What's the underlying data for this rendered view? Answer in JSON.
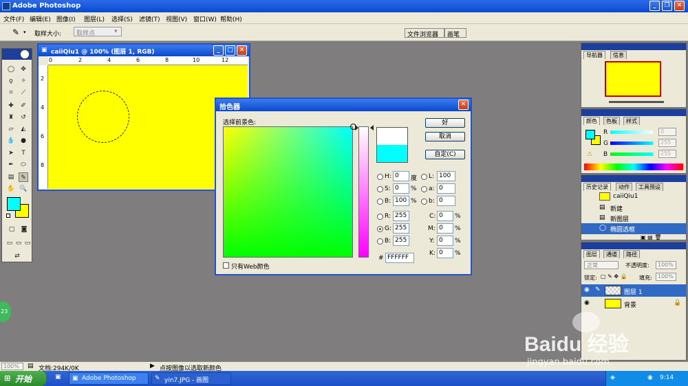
{
  "app": {
    "title": "Adobe Photoshop"
  },
  "menu": [
    "文件(F)",
    "编辑(E)",
    "图像(I)",
    "图层(L)",
    "选择(S)",
    "滤镜(T)",
    "视图(V)",
    "窗口(W)",
    "帮助(H)"
  ],
  "options": {
    "sample_label": "取样大小:",
    "sample_value": "取样点"
  },
  "tab_well": {
    "tabs": [
      "文件浏览器",
      "画笔"
    ]
  },
  "document": {
    "title": "caiiQiu1 @ 100% (图层 1, RGB)",
    "ruler_h": [
      "0",
      "2",
      "4",
      "6",
      "8",
      "10",
      "12"
    ],
    "ruler_v": [
      "2",
      "4",
      "6",
      "8"
    ]
  },
  "dialog": {
    "title": "拾色器",
    "prompt": "选择前景色:",
    "ok": "好",
    "cancel": "取消",
    "custom": "自定(C)",
    "web_only": "只有Web颜色",
    "hsb": [
      {
        "label": "H:",
        "value": "0",
        "unit": "度"
      },
      {
        "label": "S:",
        "value": "0",
        "unit": "%"
      },
      {
        "label": "B:",
        "value": "100",
        "unit": "%"
      }
    ],
    "lab": [
      {
        "label": "L:",
        "value": "100"
      },
      {
        "label": "a:",
        "value": "0"
      },
      {
        "label": "b:",
        "value": "0"
      }
    ],
    "rgb": [
      {
        "label": "R:",
        "value": "255"
      },
      {
        "label": "G:",
        "value": "255"
      },
      {
        "label": "B:",
        "value": "255"
      }
    ],
    "cmyk": [
      {
        "label": "C:",
        "value": "0",
        "unit": "%"
      },
      {
        "label": "M:",
        "value": "0",
        "unit": "%"
      },
      {
        "label": "Y:",
        "value": "0",
        "unit": "%"
      },
      {
        "label": "K:",
        "value": "0",
        "unit": "%"
      }
    ],
    "hex_label": "#",
    "hex": "FFFFFF",
    "new_color": "#ffffff",
    "current_color": "#00ffff"
  },
  "navigator": {
    "tabs": [
      "导航器",
      "信息"
    ]
  },
  "color_panel": {
    "tabs": [
      "颜色",
      "色板",
      "样式"
    ],
    "sliders": [
      {
        "label": "R",
        "value": "0"
      },
      {
        "label": "G",
        "value": "255"
      },
      {
        "label": "B",
        "value": "255"
      }
    ]
  },
  "history": {
    "tabs": [
      "历史记录",
      "动作",
      "工具预设"
    ],
    "snapshot": "caiiQiu1",
    "items": [
      "新建",
      "新图层",
      "椭圆选框"
    ]
  },
  "layers": {
    "tabs": [
      "图层",
      "通道",
      "路径"
    ],
    "blend_mode": "正常",
    "opacity_label": "不透明度:",
    "opacity": "100%",
    "lock_label": "锁定:",
    "fill_label": "填充:",
    "fill": "100%",
    "items": [
      "图层 1",
      "背景"
    ]
  },
  "status": {
    "zoom": "100%",
    "doc": "文档:294K/0K",
    "hint": "点按图像以选取新颜色"
  },
  "taskbar": {
    "start": "开始",
    "tasks": [
      "Adobe Photoshop",
      "yin7.JPG - 画图"
    ],
    "clock": "9:14"
  },
  "badge": "23",
  "watermark": {
    "brand": "Baidu 经验",
    "url": "jingyan.baidu.com"
  },
  "colors": {
    "fg": "#00ffff",
    "bg": "#ffff00",
    "canvas": "#ffff00",
    "title_blue": "#0b49cc"
  }
}
